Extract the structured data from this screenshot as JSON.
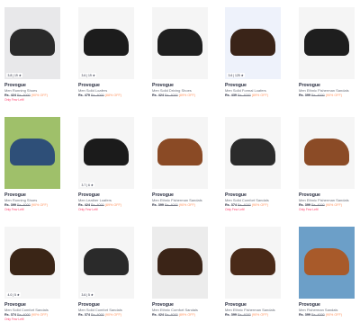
{
  "products": [
    {
      "brand": "Provogue",
      "name": "Men Running Shoes",
      "price": "Rs. 424",
      "mrp": "Rs. 4000",
      "off": "(90% OFF)",
      "tag": "Only Few Left!",
      "rating": "3.8 | 19",
      "bg": "#e8e8ea",
      "shoe": "#2a2a2a"
    },
    {
      "brand": "Provogue",
      "name": "Men Solid Loafers",
      "price": "Rs. 479",
      "mrp": "Rs. 4000",
      "off": "(88% OFF)",
      "tag": "",
      "rating": "3.6 | 19",
      "bg": "#f5f5f5",
      "shoe": "#1c1c1c"
    },
    {
      "brand": "Provogue",
      "name": "Men Solid Driving Shoes",
      "price": "Rs. 424",
      "mrp": "Rs. 4000",
      "off": "(89% OFF)",
      "tag": "",
      "rating": "",
      "bg": "#f5f5f5",
      "shoe": "#1f1f1f"
    },
    {
      "brand": "Provogue",
      "name": "Men Solid Formal Loafers",
      "price": "Rs. 439",
      "mrp": "Rs. 4000",
      "off": "(89% OFF)",
      "tag": "",
      "rating": "3.6 | 125",
      "bg": "#eef2fb",
      "shoe": "#3a2418"
    },
    {
      "brand": "Provogue",
      "name": "Men Ethnic Fisherman Sandals",
      "price": "Rs. 399",
      "mrp": "Rs. 4000",
      "off": "(90% OFF)",
      "tag": "",
      "rating": "",
      "bg": "#f5f5f5",
      "shoe": "#1e1e1e"
    },
    {
      "brand": "Provogue",
      "name": "Men Running Shoes",
      "price": "Rs. 399",
      "mrp": "Rs. 4000",
      "off": "(90% OFF)",
      "tag": "Only Few Left!",
      "rating": "",
      "bg": "#9fc06a",
      "shoe": "#2e4f78"
    },
    {
      "brand": "Provogue",
      "name": "Men Leather Loafers",
      "price": "Rs. 424",
      "mrp": "Rs. 4000",
      "off": "(89% OFF)",
      "tag": "Only Few Left!",
      "rating": "3.7 | 6",
      "bg": "#f5f5f5",
      "shoe": "#1b1b1b"
    },
    {
      "brand": "Provogue",
      "name": "Men Ethnic Fisherman Sandals",
      "price": "Rs. 399",
      "mrp": "Rs. 4000",
      "off": "(90% OFF)",
      "tag": "",
      "rating": "",
      "bg": "#f5f5f5",
      "shoe": "#8a4a25"
    },
    {
      "brand": "Provogue",
      "name": "Men Solid Comfort Sandals",
      "price": "Rs. 374",
      "mrp": "Rs. 4000",
      "off": "(90% OFF)",
      "tag": "Only Few Left!",
      "rating": "",
      "bg": "#f5f5f5",
      "shoe": "#2b2b2b"
    },
    {
      "brand": "Provogue",
      "name": "Men Ethnic Fisherman Sandals",
      "price": "Rs. 399",
      "mrp": "Rs. 4000",
      "off": "(90% OFF)",
      "tag": "Only Few Left!",
      "rating": "",
      "bg": "#f5f5f5",
      "shoe": "#8b4b26"
    },
    {
      "brand": "Provogue",
      "name": "Men Solid Comfort Sandals",
      "price": "Rs. 374",
      "mrp": "Rs. 4000",
      "off": "(90% OFF)",
      "tag": "Only Few Left!",
      "rating": "4.0 | 5",
      "bg": "#f5f5f5",
      "shoe": "#3a2516"
    },
    {
      "brand": "Provogue",
      "name": "Men Solid Comfort Sandals",
      "price": "Rs. 374",
      "mrp": "Rs. 4000",
      "off": "(90% OFF)",
      "tag": "",
      "rating": "3.6 | 5",
      "bg": "#f5f5f5",
      "shoe": "#2a2a2a"
    },
    {
      "brand": "Provogue",
      "name": "Men Ethnic Comfort Sandals",
      "price": "Rs. 424",
      "mrp": "Rs. 4000",
      "off": "(89% OFF)",
      "tag": "",
      "rating": "",
      "bg": "#ececec",
      "shoe": "#3b2417"
    },
    {
      "brand": "Provogue",
      "name": "Men Ethnic Fisherman Sandals",
      "price": "Rs. 399",
      "mrp": "Rs. 4000",
      "off": "(90% OFF)",
      "tag": "",
      "rating": "",
      "bg": "#f5f5f5",
      "shoe": "#4a2a18"
    },
    {
      "brand": "Provogue",
      "name": "Men Fisherman Sandals",
      "price": "Rs. 399",
      "mrp": "Rs. 4000",
      "off": "(90% OFF)",
      "tag": "",
      "rating": "",
      "bg": "#6c9fc8",
      "shoe": "#a85a2a"
    }
  ]
}
